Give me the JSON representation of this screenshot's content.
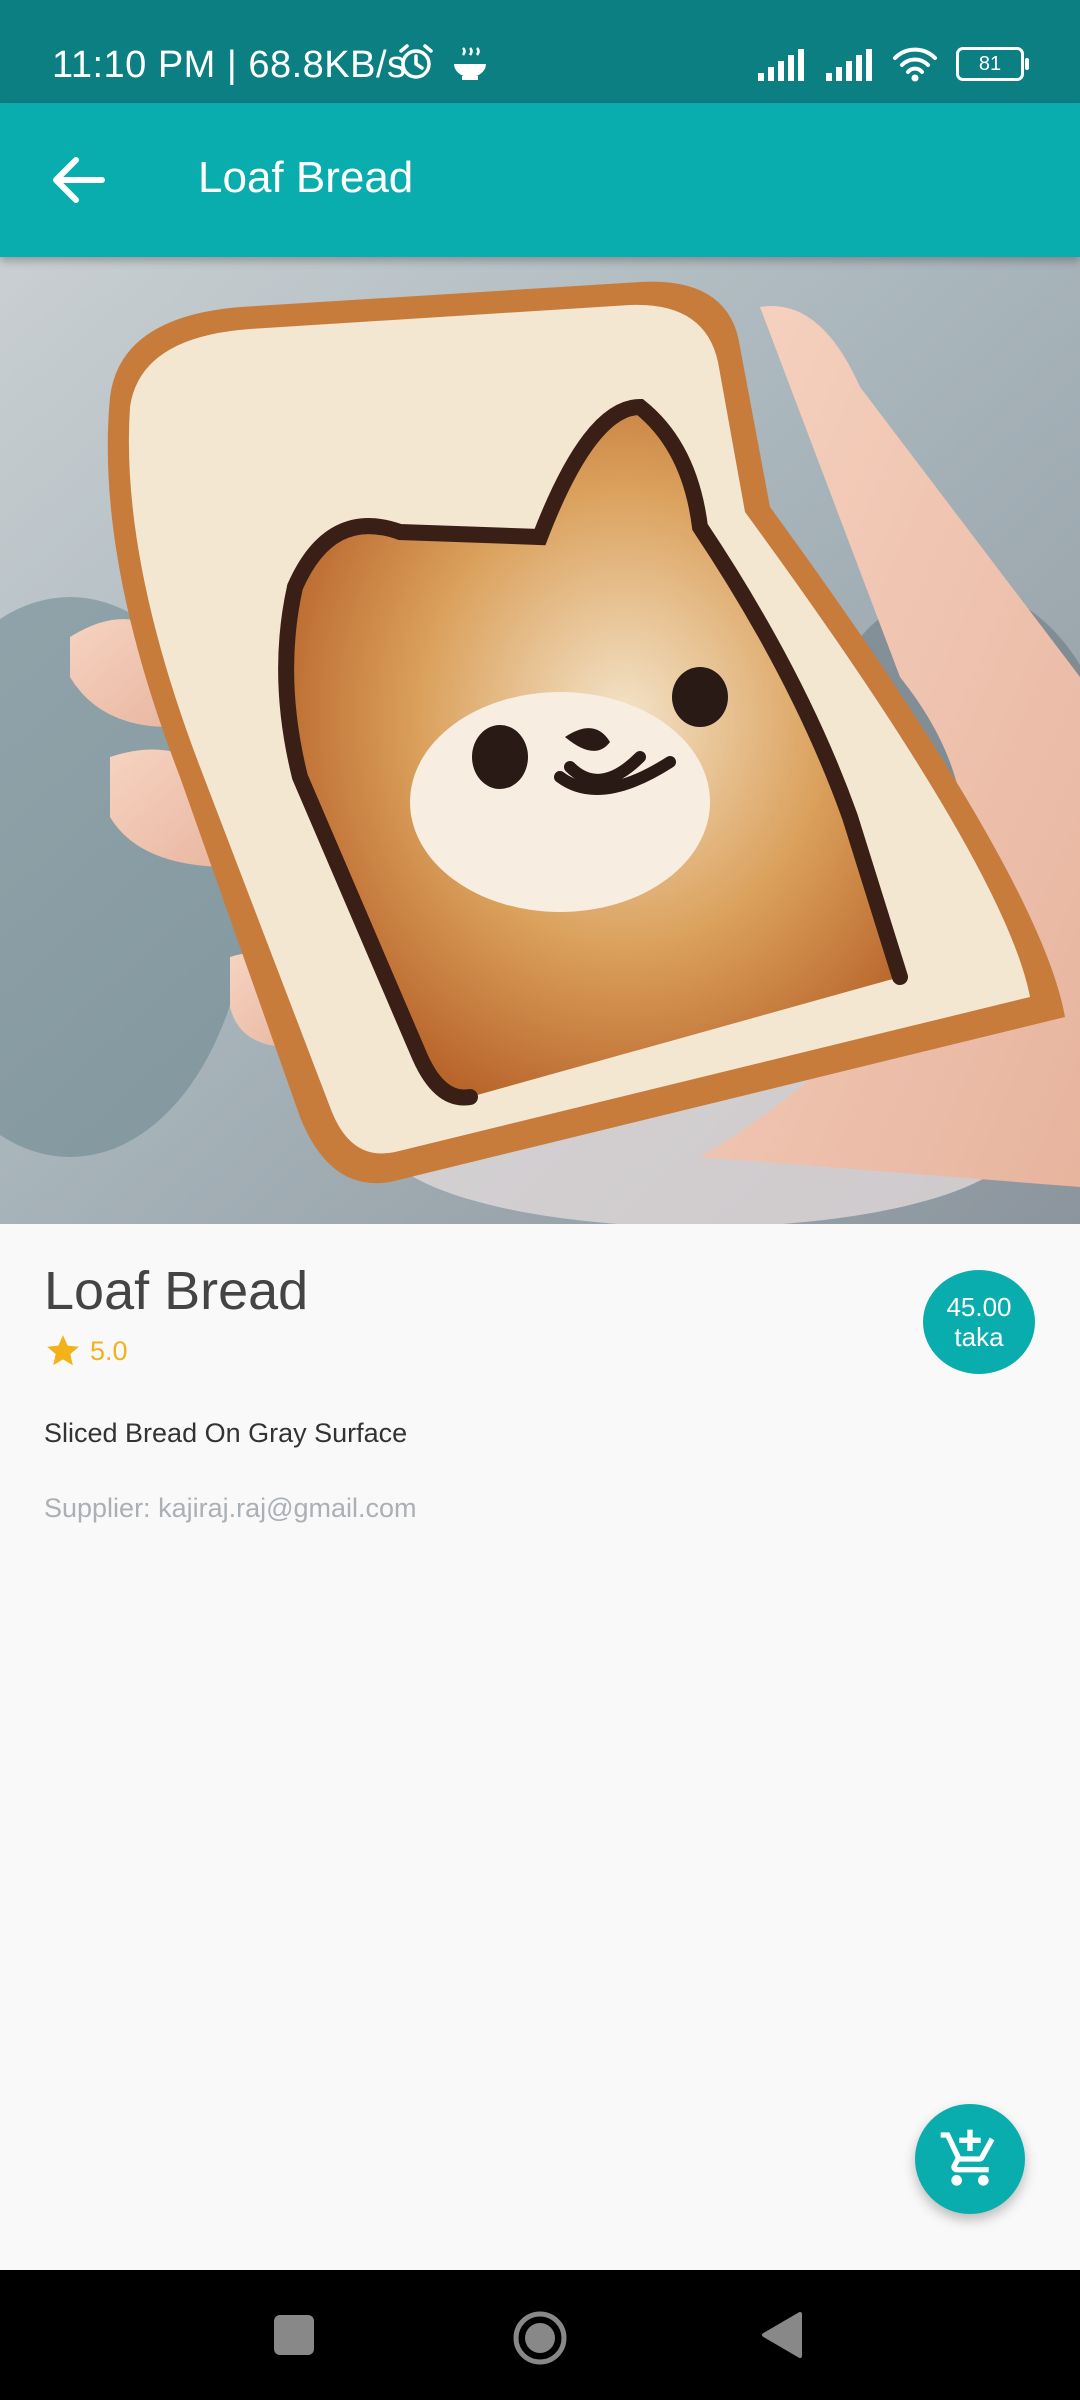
{
  "status_bar": {
    "time": "11:10 PM | 68.8KB/s",
    "battery": "81",
    "icons": [
      "alarm-icon",
      "steam-bowl-icon",
      "signal-icon",
      "signal-icon",
      "wifi-icon",
      "battery-icon"
    ]
  },
  "app_bar": {
    "title": "Loaf Bread",
    "back_icon": "arrow-back-icon"
  },
  "product": {
    "name": "Loaf Bread",
    "rating": "5.0",
    "price_amount": "45.00",
    "price_unit": "taka",
    "description": "Sliced Bread On Gray Surface",
    "supplier": "Supplier: kajiraj.raj@gmail.com"
  },
  "fab": {
    "icon": "add-to-cart-icon"
  },
  "nav_bar": {
    "icons": [
      "recents-icon",
      "home-icon",
      "back-icon"
    ]
  },
  "colors": {
    "status_bar": "#0c7f83",
    "app_bar": "#0aadad",
    "accent": "#0aadad",
    "rating": "#f2b21a"
  }
}
